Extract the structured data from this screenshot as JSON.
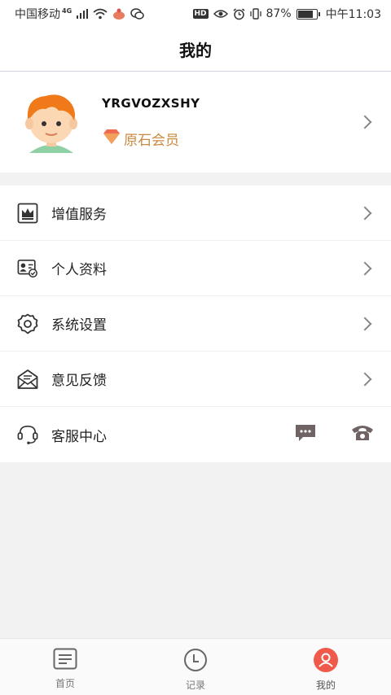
{
  "status_bar": {
    "carrier": "中国移动",
    "network": "4G",
    "hd": "HD",
    "battery_text": "87%",
    "battery_level": 0.87,
    "time": "中午11:03"
  },
  "title": "我的",
  "profile": {
    "username": "YRGVOZXSHY",
    "membership": "原石会员"
  },
  "menu": [
    {
      "label": "增值服务",
      "icon": "crown-icon"
    },
    {
      "label": "个人资料",
      "icon": "id-card-icon"
    },
    {
      "label": "系统设置",
      "icon": "gear-icon"
    },
    {
      "label": "意见反馈",
      "icon": "envelope-icon"
    },
    {
      "label": "客服中心",
      "icon": "headset-icon"
    }
  ],
  "tabs": [
    {
      "label": "首页",
      "icon": "home-icon"
    },
    {
      "label": "记录",
      "icon": "clock-icon"
    },
    {
      "label": "我的",
      "icon": "user-icon",
      "active": true
    }
  ],
  "colors": {
    "accent_gold": "#c98a3e",
    "tab_active": "#ef5a4a",
    "icon_gray": "#666666"
  }
}
